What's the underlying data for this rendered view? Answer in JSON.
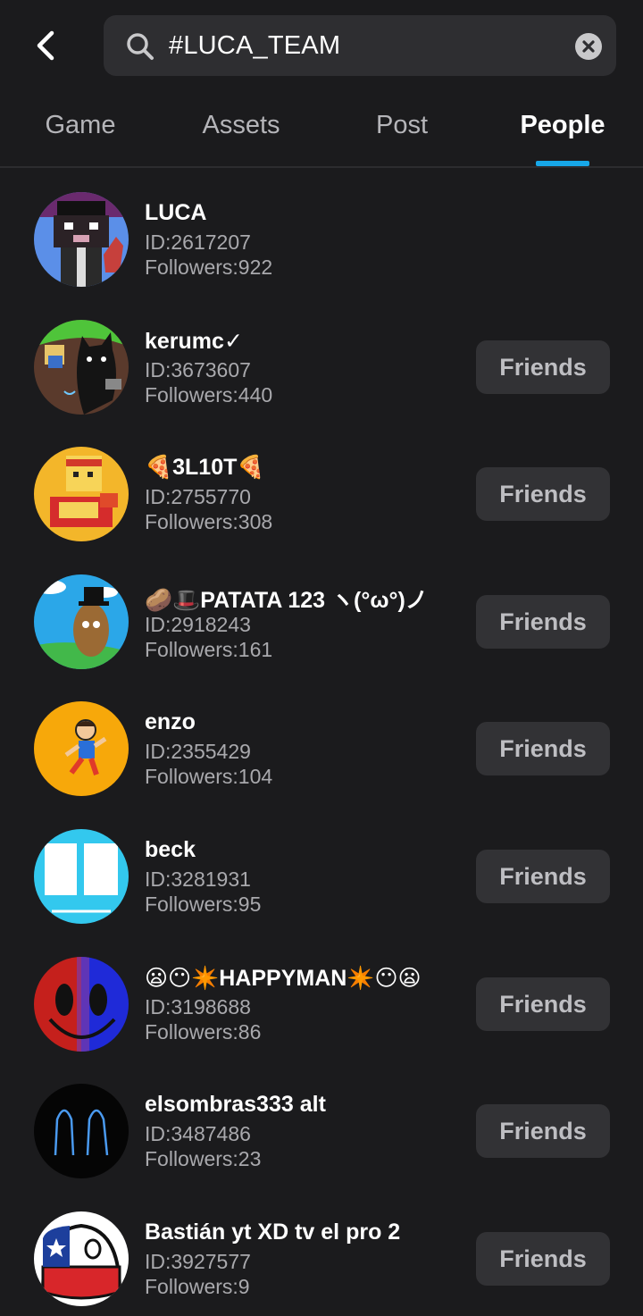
{
  "search": {
    "query": "#LUCA_TEAM"
  },
  "tabs": [
    {
      "label": "Game"
    },
    {
      "label": "Assets"
    },
    {
      "label": "Post"
    },
    {
      "label": "People",
      "active": true
    }
  ],
  "colors": {
    "background": "#1b1b1d",
    "search_bg": "#2e2e31",
    "accent": "#17a7e8",
    "button_bg": "#323235",
    "secondary_text": "#a9a9ad"
  },
  "icons": {
    "back": "chevron-left-icon",
    "search": "magnifier-icon",
    "clear": "close-circle-icon"
  },
  "users": [
    {
      "name": "LUCA",
      "id": "ID:2617207",
      "followers": "Followers:922",
      "button": ""
    },
    {
      "name": "kerumc✓",
      "id": "ID:3673607",
      "followers": "Followers:440",
      "button": "Friends"
    },
    {
      "name": "🍕3L10T🍕",
      "id": "ID:2755770",
      "followers": "Followers:308",
      "button": "Friends"
    },
    {
      "name": "🥔🎩PATATA 123 ヽ(°ω°)ノ",
      "id": "ID:2918243",
      "followers": "Followers:161",
      "button": "Friends"
    },
    {
      "name": "enzo",
      "id": "ID:2355429",
      "followers": "Followers:104",
      "button": "Friends"
    },
    {
      "name": "beck",
      "id": "ID:3281931",
      "followers": "Followers:95",
      "button": "Friends"
    },
    {
      "name": "😦😶✴️HAPPYMAN✴️😶😦",
      "id": "ID:3198688",
      "followers": "Followers:86",
      "button": "Friends"
    },
    {
      "name": "elsombras333 alt",
      "id": "ID:3487486",
      "followers": "Followers:23",
      "button": "Friends"
    },
    {
      "name": "Bastián yt XD tv el pro 2",
      "id": "ID:3927577",
      "followers": "Followers:9",
      "button": "Friends"
    }
  ]
}
